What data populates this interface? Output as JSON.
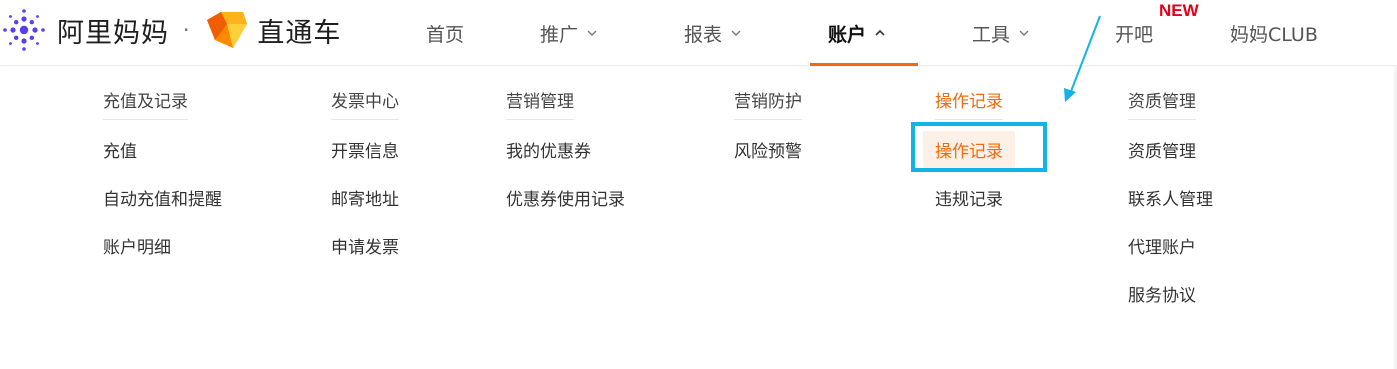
{
  "brand": {
    "name": "阿里妈妈",
    "separator": "·",
    "product": "直通车",
    "logo_icon": "alimama-logo-icon",
    "product_icon": "zhitongche-logo-icon"
  },
  "nav": {
    "items": [
      {
        "label": "首页"
      },
      {
        "label": "推广"
      },
      {
        "label": "报表"
      },
      {
        "label": "账户"
      },
      {
        "label": "工具"
      },
      {
        "label": "开吧"
      },
      {
        "label": "妈妈CLUB"
      }
    ],
    "new_badge": "NEW",
    "active_label": "账户"
  },
  "menu": {
    "columns": [
      {
        "title": "充值及记录",
        "items": [
          "充值",
          "自动充值和提醒",
          "账户明细"
        ]
      },
      {
        "title": "发票中心",
        "items": [
          "开票信息",
          "邮寄地址",
          "申请发票"
        ]
      },
      {
        "title": "营销管理",
        "items": [
          "我的优惠券",
          "优惠券使用记录"
        ]
      },
      {
        "title": "营销防护",
        "items": [
          "风险预警"
        ]
      },
      {
        "title": "操作记录",
        "items": [
          "操作记录",
          "违规记录"
        ]
      },
      {
        "title": "资质管理",
        "items": [
          "资质管理",
          "联系人管理",
          "代理账户",
          "服务协议"
        ]
      }
    ]
  },
  "colors": {
    "accent": "#f06b10",
    "highlight_bg": "#fdf1e7",
    "annotation": "#12b3e6",
    "new_badge": "#e3001b"
  }
}
